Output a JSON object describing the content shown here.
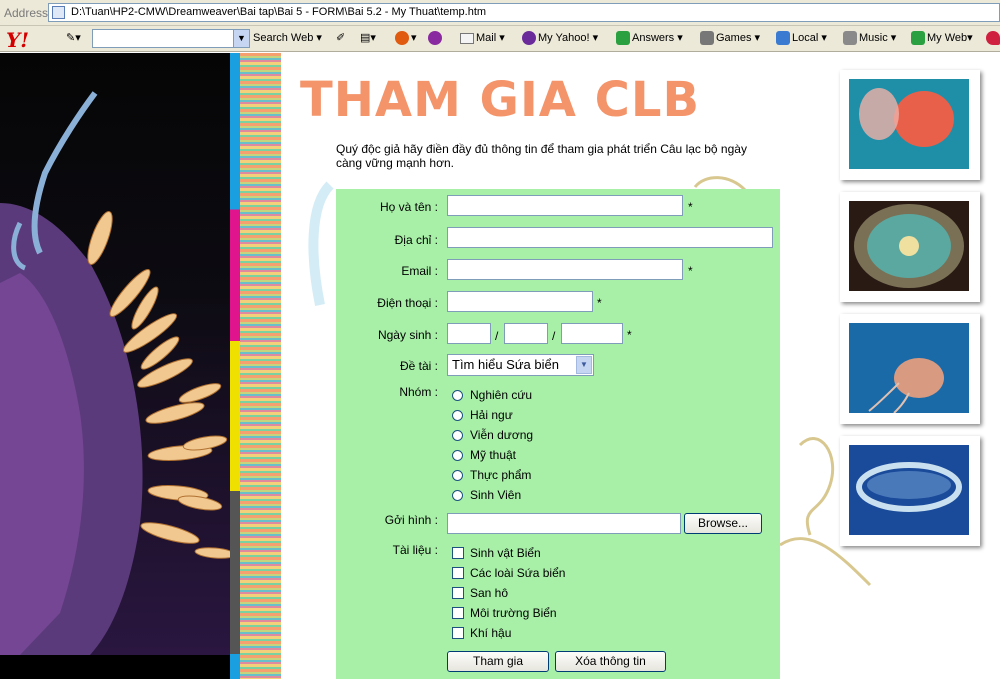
{
  "browser": {
    "address_label": "Address",
    "url": "D:\\Tuan\\HP2-CMW\\Dreamweaver\\Bai tap\\Bai 5 - FORM\\Bai 5.2 - My Thuat\\temp.htm"
  },
  "toolbar": {
    "logo": "Y!",
    "search_web": "Search Web",
    "mail": "Mail",
    "my_yahoo": "My Yahoo!",
    "answers": "Answers",
    "games": "Games",
    "local": "Local",
    "music": "Music",
    "my_web": "My Web"
  },
  "page": {
    "title": "THAM GIA CLB",
    "intro": "Quý độc giả hãy điền đầy đủ thông tin để tham gia phát triển Câu lạc bộ ngày càng vững mạnh hơn."
  },
  "form": {
    "name_label": "Họ và tên :",
    "address_label": "Địa chỉ :",
    "email_label": "Email :",
    "phone_label": "Điện thoại :",
    "birth_label": "Ngày sinh :",
    "topic_label": "Đề tài :",
    "group_label": "Nhóm :",
    "send_label": "Gởi hình :",
    "docs_label": "Tài liệu :",
    "required_mark": "*",
    "date_sep": "/",
    "topic_selected": "Tìm hiểu Sứa biển",
    "groups": [
      "Nghiên cứu",
      "Hải ngư",
      "Viễn dương",
      "Mỹ thuật",
      "Thực phẩm",
      "Sinh Viên"
    ],
    "docs": [
      "Sinh vật Biển",
      "Các loài Sứa biển",
      "San hô",
      "Môi trường Biển",
      "Khí hậu"
    ],
    "browse_button": "Browse...",
    "submit_button": "Tham gia",
    "reset_button": "Xóa thông tin"
  },
  "colors": {
    "title": "#f4946a",
    "form_bg": "#a8f0a8"
  }
}
